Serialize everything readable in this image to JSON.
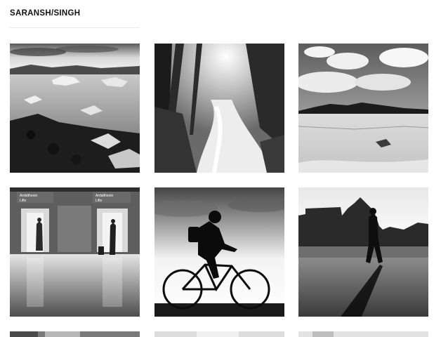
{
  "site": {
    "title": "SARANSH/SINGH"
  },
  "gallery": {
    "photos": [
      {
        "subject": "ice on a black beach"
      },
      {
        "subject": "forest waterfall"
      },
      {
        "subject": "desert with distant mountains"
      },
      {
        "subject": "lifts in a station hall"
      },
      {
        "subject": "cyclist silhouette"
      },
      {
        "subject": "pedestrian silhouette by a building"
      },
      {
        "subject": "partially visible photo"
      },
      {
        "subject": "partially visible photo"
      },
      {
        "subject": "partially visible photo"
      }
    ],
    "lift_sign_left": {
      "line1": "Ardaltheoin",
      "line2": "Lifts"
    },
    "lift_sign_right": {
      "line1": "Ardaltheoin",
      "line2": "Lifts"
    }
  },
  "colors": {
    "background": "#ffffff",
    "title": "#111111",
    "divider": "#ececec"
  }
}
